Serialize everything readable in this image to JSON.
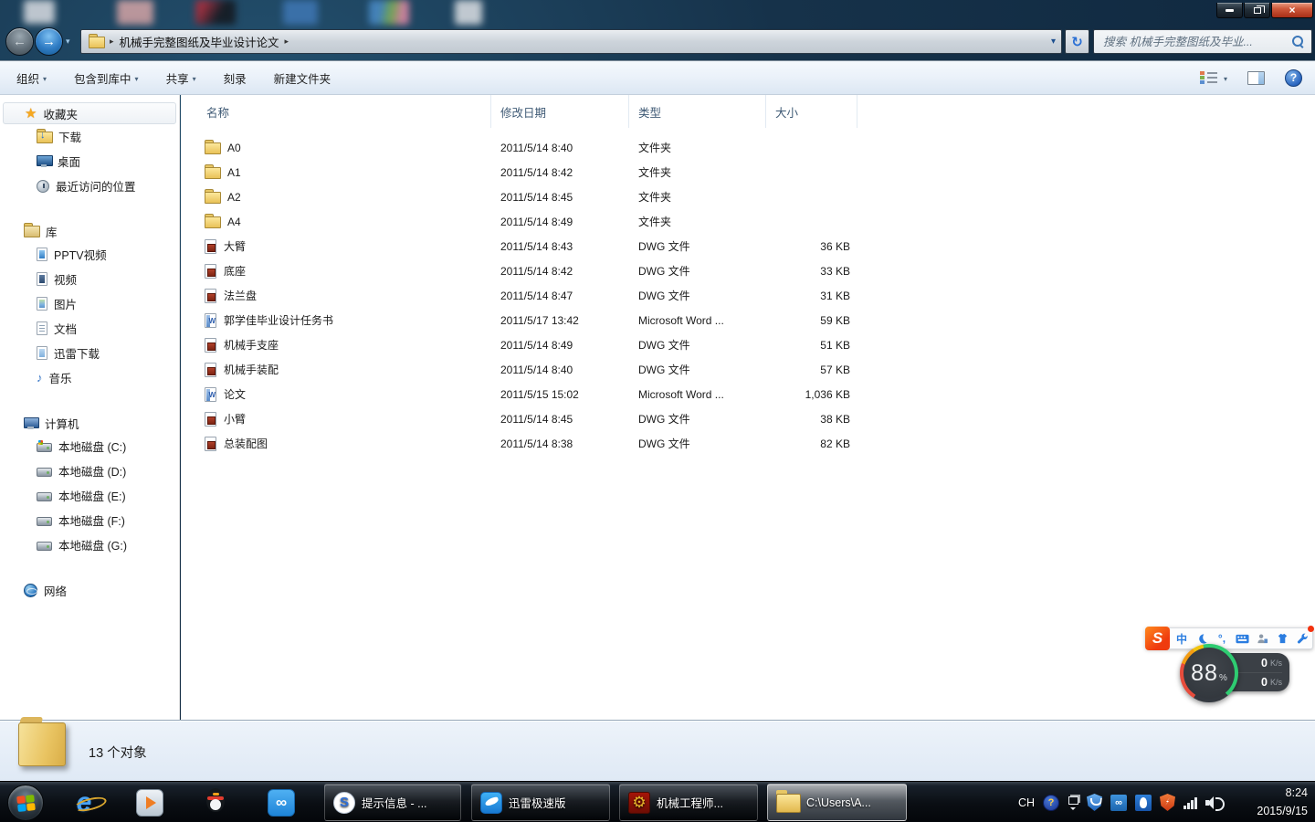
{
  "address": {
    "segment": "机械手完整图纸及毕业设计论文"
  },
  "search": {
    "placeholder": "搜索 机械手完整图纸及毕业..."
  },
  "toolbar": {
    "items": [
      {
        "name": "organize",
        "label": "组织",
        "arrow": true
      },
      {
        "name": "include-in-library",
        "label": "包含到库中",
        "arrow": true
      },
      {
        "name": "share",
        "label": "共享",
        "arrow": true
      },
      {
        "name": "burn",
        "label": "刻录",
        "arrow": false
      },
      {
        "name": "new-folder",
        "label": "新建文件夹",
        "arrow": false
      }
    ]
  },
  "columns": {
    "name": "名称",
    "date": "修改日期",
    "type": "类型",
    "size": "大小"
  },
  "files": [
    {
      "icon": "folder",
      "name": "A0",
      "date": "2011/5/14 8:40",
      "type": "文件夹",
      "size": ""
    },
    {
      "icon": "folder",
      "name": "A1",
      "date": "2011/5/14 8:42",
      "type": "文件夹",
      "size": ""
    },
    {
      "icon": "folder",
      "name": "A2",
      "date": "2011/5/14 8:45",
      "type": "文件夹",
      "size": ""
    },
    {
      "icon": "folder",
      "name": "A4",
      "date": "2011/5/14 8:49",
      "type": "文件夹",
      "size": ""
    },
    {
      "icon": "dwg",
      "name": "大臂",
      "date": "2011/5/14 8:43",
      "type": "DWG 文件",
      "size": "36 KB"
    },
    {
      "icon": "dwg",
      "name": "底座",
      "date": "2011/5/14 8:42",
      "type": "DWG 文件",
      "size": "33 KB"
    },
    {
      "icon": "dwg",
      "name": "法兰盘",
      "date": "2011/5/14 8:47",
      "type": "DWG 文件",
      "size": "31 KB"
    },
    {
      "icon": "word",
      "name": "郭学佳毕业设计任务书",
      "date": "2011/5/17 13:42",
      "type": "Microsoft Word ...",
      "size": "59 KB"
    },
    {
      "icon": "dwg",
      "name": "机械手支座",
      "date": "2011/5/14 8:49",
      "type": "DWG 文件",
      "size": "51 KB"
    },
    {
      "icon": "dwg",
      "name": "机械手装配",
      "date": "2011/5/14 8:40",
      "type": "DWG 文件",
      "size": "57 KB"
    },
    {
      "icon": "word",
      "name": "论文",
      "date": "2011/5/15 15:02",
      "type": "Microsoft Word ...",
      "size": "1,036 KB"
    },
    {
      "icon": "dwg",
      "name": "小臂",
      "date": "2011/5/14 8:45",
      "type": "DWG 文件",
      "size": "38 KB"
    },
    {
      "icon": "dwg",
      "name": "总装配图",
      "date": "2011/5/14 8:38",
      "type": "DWG 文件",
      "size": "82 KB"
    }
  ],
  "sidebar": {
    "groups": [
      {
        "name": "favorites",
        "icon": "star",
        "label": "收藏夹",
        "highlight": true,
        "items": [
          {
            "icon": "download-folder",
            "label": "下载"
          },
          {
            "icon": "desktop",
            "label": "桌面"
          },
          {
            "icon": "recent-places",
            "label": "最近访问的位置"
          }
        ]
      },
      {
        "name": "libraries",
        "icon": "library-folder",
        "label": "库",
        "highlight": false,
        "items": [
          {
            "icon": "pptv-video-library",
            "label": "PPTV视频"
          },
          {
            "icon": "video-library",
            "label": "视频"
          },
          {
            "icon": "pictures-library",
            "label": "图片"
          },
          {
            "icon": "documents-library",
            "label": "文档"
          },
          {
            "icon": "xunlei-download-library",
            "label": "迅雷下载"
          },
          {
            "icon": "music-library",
            "label": "音乐"
          }
        ]
      },
      {
        "name": "computer",
        "icon": "computer",
        "label": "计算机",
        "highlight": false,
        "items": [
          {
            "icon": "drive-c",
            "label": "本地磁盘 (C:)"
          },
          {
            "icon": "drive",
            "label": "本地磁盘 (D:)"
          },
          {
            "icon": "drive",
            "label": "本地磁盘 (E:)"
          },
          {
            "icon": "drive",
            "label": "本地磁盘 (F:)"
          },
          {
            "icon": "drive",
            "label": "本地磁盘 (G:)"
          }
        ]
      },
      {
        "name": "network",
        "icon": "network-globe",
        "label": "网络",
        "highlight": false,
        "items": []
      }
    ]
  },
  "statusbar": {
    "item_count": "13 个对象"
  },
  "taskbar": {
    "buttons": [
      {
        "name": "sogou-browser",
        "icon": "sogou",
        "label": "提示信息 - ...",
        "active": false
      },
      {
        "name": "xunlei",
        "icon": "xunlei",
        "label": "迅雷极速版",
        "active": false
      },
      {
        "name": "mechanical-engineer-app",
        "icon": "gear",
        "label": "机械工程师...",
        "active": false
      },
      {
        "name": "explorer-window",
        "icon": "folder",
        "label": "C:\\Users\\A...",
        "active": true
      }
    ],
    "tray": {
      "language": "CH",
      "time": "8:24",
      "date": "2015/9/15"
    }
  },
  "ime_bar": {
    "mode": "中",
    "punctuation": "°,"
  },
  "speed_widget": {
    "percent": "88",
    "percent_sign": "%",
    "up_value": "0",
    "up_unit": "K/s",
    "down_value": "0",
    "down_unit": "K/s"
  }
}
